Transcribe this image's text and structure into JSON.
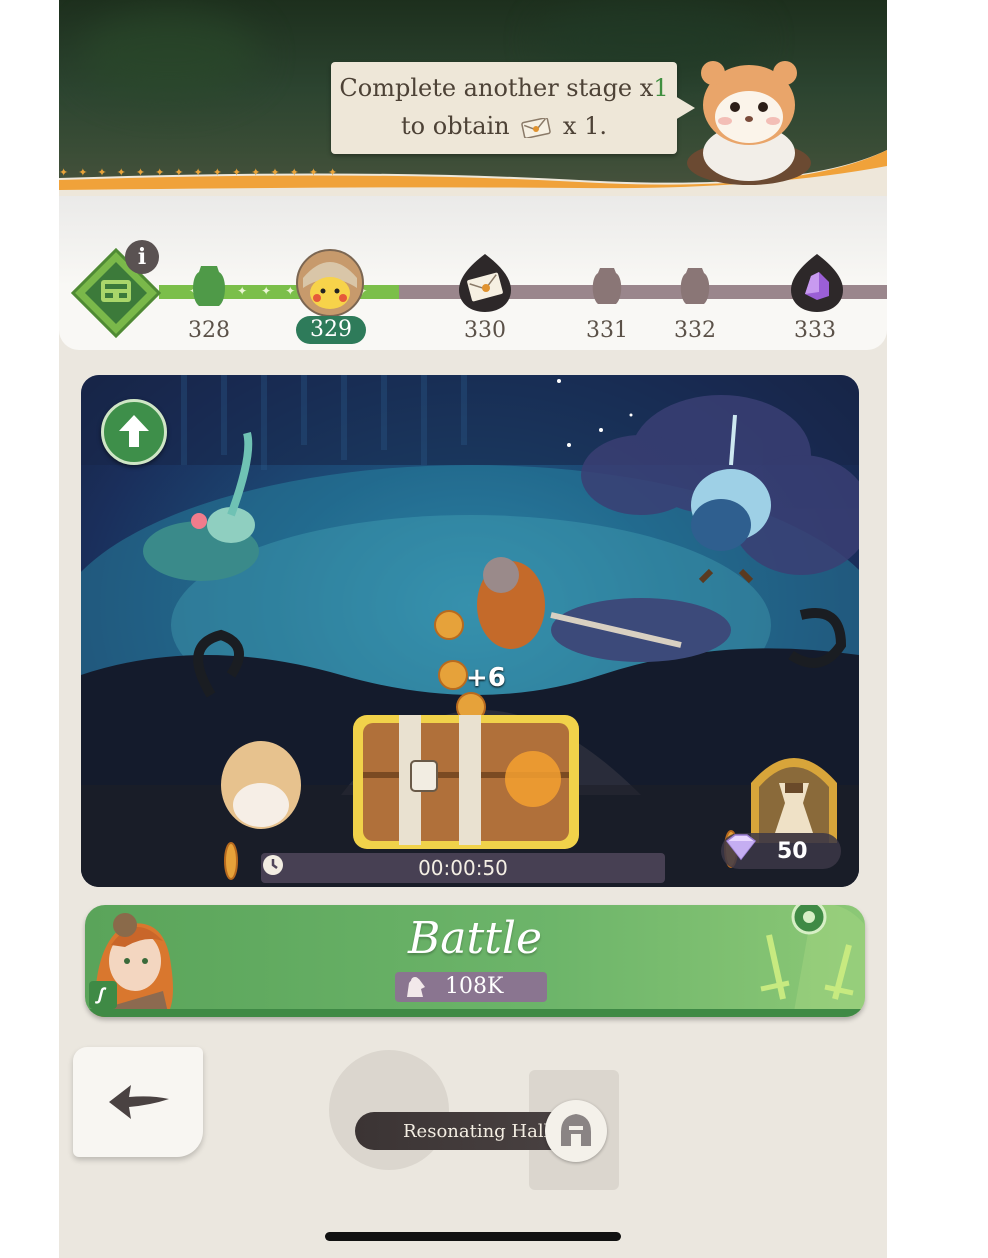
{
  "speech": {
    "line1_text": "Complete another stage x",
    "line1_accent": "1",
    "line2_prefix": "to obtain",
    "line2_suffix": "x 1."
  },
  "stages": [
    {
      "number": "328",
      "reward_icon": "chest-silhouette-icon"
    },
    {
      "number": "329",
      "reward_icon": "pikachu-avatar-icon",
      "current": true
    },
    {
      "number": "330",
      "reward_icon": "letter-icon"
    },
    {
      "number": "331",
      "reward_icon": "chest-silhouette-icon"
    },
    {
      "number": "332",
      "reward_icon": "chest-silhouette-icon"
    },
    {
      "number": "333",
      "reward_icon": "purple-crystal-icon"
    }
  ],
  "info_badge": "i",
  "scene": {
    "gold_gain": "+6",
    "timer": "00:00:50",
    "gem_count": "50"
  },
  "battle": {
    "label": "Battle",
    "power": "108K"
  },
  "resonating_hall": {
    "label": "Resonating Hall"
  },
  "colors": {
    "accent_green": "#5aa45a",
    "track_done": "#7bbf4a",
    "track_pending": "#9a868c",
    "current_stage_badge": "#2e7b5a",
    "banner_orange": "#f0a23a"
  }
}
